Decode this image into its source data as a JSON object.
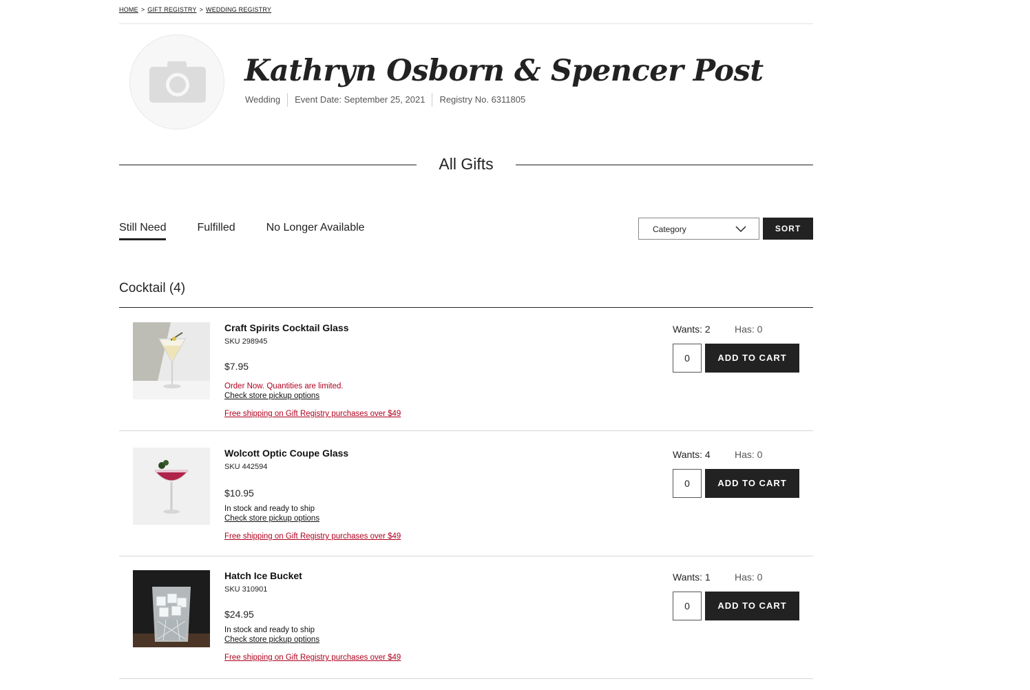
{
  "breadcrumb": {
    "home": "HOME",
    "sep": ">",
    "gift_registry": "GIFT REGISTRY",
    "wedding_registry": "WEDDING REGISTRY"
  },
  "registry": {
    "name": "Kathryn Osborn & Spencer Post",
    "type": "Wedding",
    "event_date": "Event Date: September 25, 2021",
    "registry_no": "Registry No. 6311805"
  },
  "section_title": "All Gifts",
  "tabs": [
    {
      "label": "Still Need",
      "active": true
    },
    {
      "label": "Fulfilled",
      "active": false
    },
    {
      "label": "No Longer Available",
      "active": false
    }
  ],
  "sort": {
    "select_value": "Category",
    "button_label": "SORT"
  },
  "category_heading": "Cocktail (4)",
  "items": [
    {
      "name": "Craft Spirits Cocktail Glass",
      "sku": "SKU 298945",
      "price": "$7.95",
      "stock": "Order Now. Quantities are limited.",
      "stock_color": "#b0001e",
      "pickup": "Check store pickup options",
      "shipping": "Free shipping on Gift Registry purchases over $49",
      "wants": "Wants: 2",
      "has": "Has: 0",
      "qty": "0",
      "cart_label": "ADD TO CART",
      "image": "martini-glass-image"
    },
    {
      "name": "Wolcott Optic Coupe Glass",
      "sku": "SKU 442594",
      "price": "$10.95",
      "stock": "In stock and ready to ship",
      "stock_color": "#111111",
      "pickup": "Check store pickup options",
      "shipping": "Free shipping on Gift Registry purchases over $49",
      "wants": "Wants: 4",
      "has": "Has: 0",
      "qty": "0",
      "cart_label": "ADD TO CART",
      "image": "coupe-glass-image"
    },
    {
      "name": "Hatch Ice Bucket",
      "sku": "SKU 310901",
      "price": "$24.95",
      "stock": "In stock and ready to ship",
      "stock_color": "#111111",
      "pickup": "Check store pickup options",
      "shipping": "Free shipping on Gift Registry purchases over $49",
      "wants": "Wants: 1",
      "has": "Has: 0",
      "qty": "0",
      "cart_label": "ADD TO CART",
      "image": "ice-bucket-image"
    }
  ]
}
